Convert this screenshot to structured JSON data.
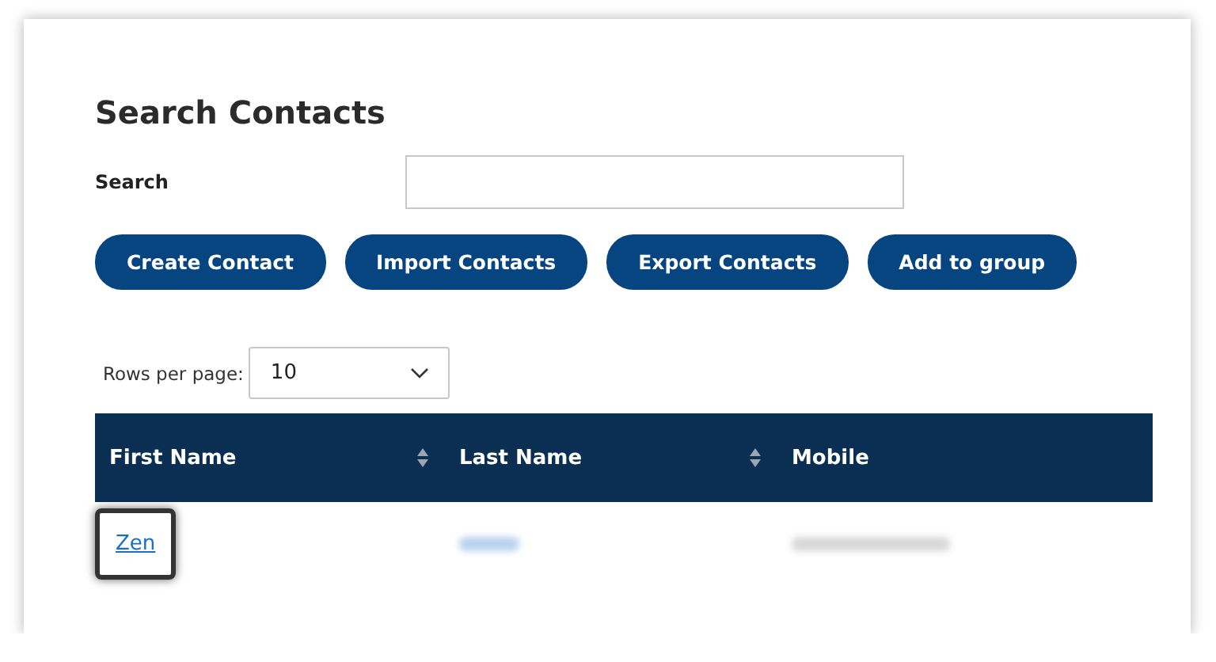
{
  "title": "Search Contacts",
  "search": {
    "label": "Search"
  },
  "buttons": [
    "Create Contact",
    "Import Contacts",
    "Export Contacts",
    "Add to group"
  ],
  "rows_per_page": {
    "label": "Rows per page:",
    "value": "10"
  },
  "table": {
    "columns": [
      {
        "label": "First Name",
        "sortable": true
      },
      {
        "label": "Last Name",
        "sortable": true
      },
      {
        "label": "Mobile",
        "sortable": false
      }
    ],
    "rows": [
      {
        "first_name": "Zen",
        "highlighted": true
      }
    ]
  }
}
